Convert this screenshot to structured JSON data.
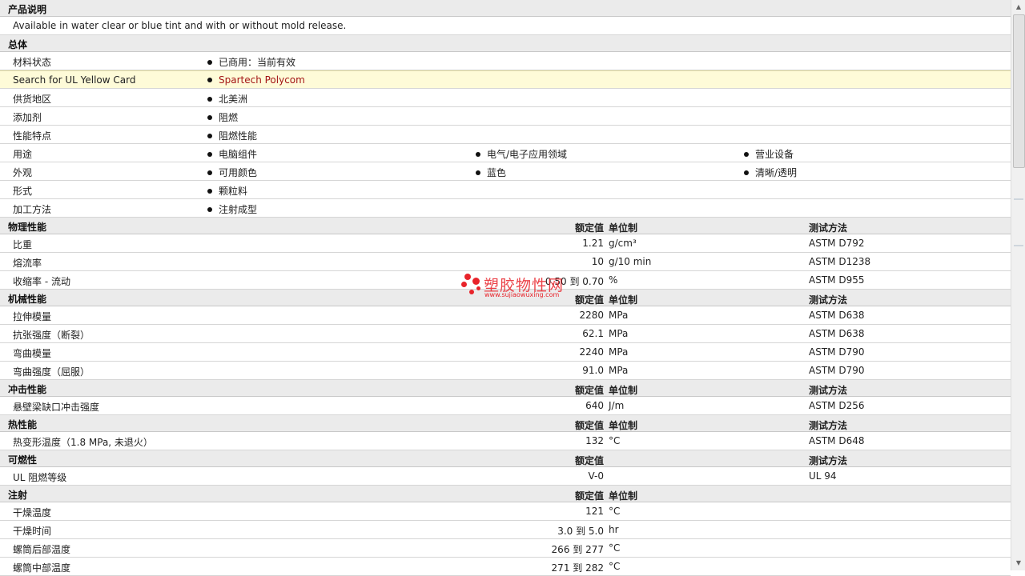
{
  "description_section": {
    "title": "产品说明",
    "text": "Available in water clear or blue tint and with or without mold release."
  },
  "general": {
    "title": "总体",
    "rows": [
      {
        "label": "材料状态",
        "values": [
          "已商用：当前有效"
        ]
      },
      {
        "label": "Search for UL Yellow Card",
        "values": [
          "Spartech Polycom"
        ],
        "highlight": true
      },
      {
        "label": "供货地区",
        "values": [
          "北美洲"
        ]
      },
      {
        "label": "添加剂",
        "values": [
          "阻燃"
        ]
      },
      {
        "label": "性能特点",
        "values": [
          "阻燃性能"
        ]
      },
      {
        "label": "用途",
        "values": [
          "电脑组件",
          "电气/电子应用领域",
          "营业设备"
        ]
      },
      {
        "label": "外观",
        "values": [
          "可用颜色",
          "蓝色",
          "清晰/透明"
        ]
      },
      {
        "label": "形式",
        "values": [
          "颗粒料"
        ]
      },
      {
        "label": "加工方法",
        "values": [
          "注射成型"
        ]
      }
    ]
  },
  "property_sections": [
    {
      "title": "物理性能",
      "col_nominal": "额定值",
      "col_unit": "单位制",
      "col_method": "测试方法",
      "rows": [
        {
          "name": "比重",
          "value": "1.21",
          "unit": "g/cm³",
          "method": "ASTM D792"
        },
        {
          "name": "熔流率",
          "value": "10",
          "unit": "g/10 min",
          "method": "ASTM D1238"
        },
        {
          "name": "收缩率 - 流动",
          "value": "0.50 到 0.70",
          "unit": "%",
          "method": "ASTM D955"
        }
      ]
    },
    {
      "title": "机械性能",
      "col_nominal": "额定值",
      "col_unit": "单位制",
      "col_method": "测试方法",
      "rows": [
        {
          "name": "拉伸模量",
          "value": "2280",
          "unit": "MPa",
          "method": "ASTM D638"
        },
        {
          "name": "抗张强度（断裂）",
          "value": "62.1",
          "unit": "MPa",
          "method": "ASTM D638"
        },
        {
          "name": "弯曲模量",
          "value": "2240",
          "unit": "MPa",
          "method": "ASTM D790"
        },
        {
          "name": "弯曲强度（屈服）",
          "value": "91.0",
          "unit": "MPa",
          "method": "ASTM D790"
        }
      ]
    },
    {
      "title": "冲击性能",
      "col_nominal": "额定值",
      "col_unit": "单位制",
      "col_method": "测试方法",
      "rows": [
        {
          "name": "悬壁梁缺口冲击强度",
          "value": "640",
          "unit": "J/m",
          "method": "ASTM D256"
        }
      ]
    },
    {
      "title": "热性能",
      "col_nominal": "额定值",
      "col_unit": "单位制",
      "col_method": "测试方法",
      "rows": [
        {
          "name": "热变形温度（1.8 MPa, 未退火）",
          "value": "132",
          "unit": "°C",
          "method": "ASTM D648"
        }
      ]
    },
    {
      "title": "可燃性",
      "col_nominal": "额定值",
      "col_unit": "",
      "col_method": "测试方法",
      "rows": [
        {
          "name": "UL 阻燃等级",
          "value": "V-0",
          "unit": "",
          "method": "UL 94"
        }
      ]
    },
    {
      "title": "注射",
      "col_nominal": "额定值",
      "col_unit": "单位制",
      "col_method": "",
      "rows": [
        {
          "name": "干燥温度",
          "value": "121",
          "unit": "°C",
          "method": ""
        },
        {
          "name": "干燥时间",
          "value": "3.0 到 5.0",
          "unit": "hr",
          "method": ""
        },
        {
          "name": "螺筒后部温度",
          "value": "266 到 277",
          "unit": "°C",
          "method": ""
        },
        {
          "name": "螺筒中部温度",
          "value": "271 到 282",
          "unit": "°C",
          "method": ""
        }
      ]
    }
  ],
  "watermark": {
    "text": "塑胶物性网",
    "url": "www.sujiaowuxing.com"
  },
  "colors": {
    "section_bg": "#ebebeb",
    "highlight_bg": "#fefbd8",
    "link": "#a31515",
    "watermark": "#e8232a"
  }
}
